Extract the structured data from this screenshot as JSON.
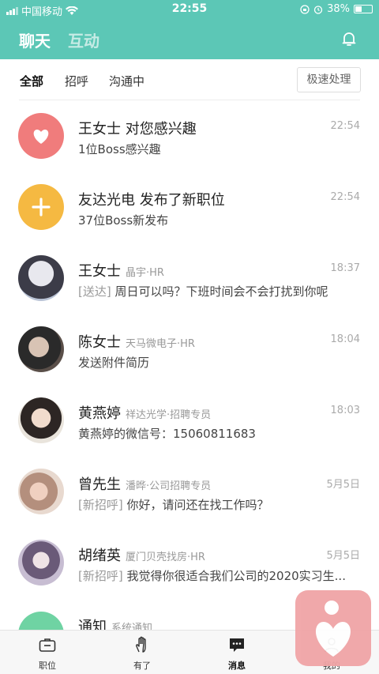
{
  "status_bar": {
    "carrier": "中国移动",
    "time": "22:55",
    "battery": "38%",
    "battery_level": 0.38
  },
  "header": {
    "tab_chat": "聊天",
    "tab_interact": "互动"
  },
  "filters": {
    "all": "全部",
    "call": "招呼",
    "talking": "沟通中",
    "quick_action": "极速处理"
  },
  "conversations": [
    {
      "name": "王女士 对您感兴趣",
      "company": "",
      "time": "22:54",
      "tag": "",
      "message": "1位Boss感兴趣"
    },
    {
      "name": "友达光电 发布了新职位",
      "company": "",
      "time": "22:54",
      "tag": "",
      "message": "37位Boss新发布"
    },
    {
      "name": "王女士",
      "company": "晶宇·HR",
      "time": "18:37",
      "tag": "[送达]",
      "message": " 周日可以吗？下班时间会不会打扰到你呢"
    },
    {
      "name": "陈女士",
      "company": "天马微电子·HR",
      "time": "18:04",
      "tag": "",
      "message": "发送附件简历"
    },
    {
      "name": "黄燕婷",
      "company": "祥达光学·招聘专员",
      "time": "18:03",
      "tag": "",
      "message": "黄燕婷的微信号：15060811683"
    },
    {
      "name": "曾先生",
      "company": "潘晔·公司招聘专员",
      "time": "5月5日",
      "tag": "[新招呼]",
      "message": " 你好，请问还在找工作吗？"
    },
    {
      "name": "胡绪英",
      "company": "厦门贝壳找房·HR",
      "time": "5月5日",
      "tag": "[新招呼]",
      "message": " 我觉得你很适合我们公司的2020实习生..."
    },
    {
      "name": "通知",
      "company": "系统通知",
      "time": "",
      "tag": "",
      "message": ""
    }
  ],
  "tabbar": {
    "jobs": "职位",
    "have": "有了",
    "messages": "消息",
    "mine": "我的"
  },
  "colors": {
    "brand": "#5cc7b6",
    "like": "#f07c7c",
    "new_job": "#f5b942"
  }
}
